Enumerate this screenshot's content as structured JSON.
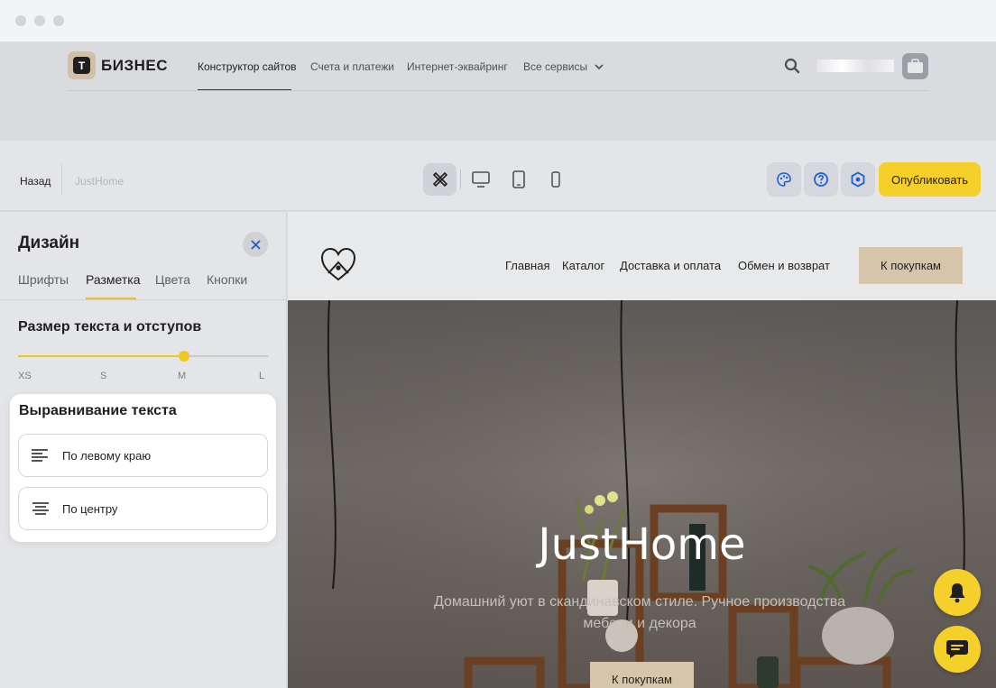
{
  "brand": {
    "badge_letter": "Т",
    "name": "БИЗНЕС"
  },
  "top_nav": [
    {
      "label": "Конструктор сайтов",
      "active": true
    },
    {
      "label": "Счета и платежи",
      "active": false
    },
    {
      "label": "Интернет-эквайринг",
      "active": false
    },
    {
      "label": "Все сервисы",
      "active": false,
      "has_dropdown": true
    }
  ],
  "editor_toolbar": {
    "back_label": "Назад",
    "site_name": "JustHome",
    "modes": [
      {
        "name": "design-mode-icon",
        "active": true
      },
      {
        "name": "desktop-icon",
        "active": false
      },
      {
        "name": "tablet-icon",
        "active": false
      },
      {
        "name": "mobile-icon",
        "active": false
      }
    ],
    "publish_label": "Опубликовать",
    "accent_color": "#f5cf2a"
  },
  "design_panel": {
    "title": "Дизайн",
    "tabs": [
      {
        "label": "Шрифты",
        "active": false
      },
      {
        "label": "Разметка",
        "active": true
      },
      {
        "label": "Цвета",
        "active": false
      },
      {
        "label": "Кнопки",
        "active": false
      }
    ],
    "size_section": {
      "title": "Размер текста и отступов",
      "options": [
        "XS",
        "S",
        "M",
        "L"
      ],
      "selected": "M",
      "selected_fraction": 0.667
    },
    "alignment_section": {
      "title": "Выравнивание текста",
      "options": [
        {
          "label": "По левому краю",
          "icon": "align-left-icon"
        },
        {
          "label": "По центру",
          "icon": "align-center-icon"
        }
      ]
    }
  },
  "site_preview": {
    "nav": [
      "Главная",
      "Каталог",
      "Доставка и оплата",
      "Обмен и возврат"
    ],
    "cta_label": "К покупкам",
    "hero_title": "JustHome",
    "hero_subtitle_line1": "Домашний уют в скандинавском стиле. Ручное производства",
    "hero_subtitle_line2": "мебели и декора",
    "hero_button": "К покупкам"
  }
}
